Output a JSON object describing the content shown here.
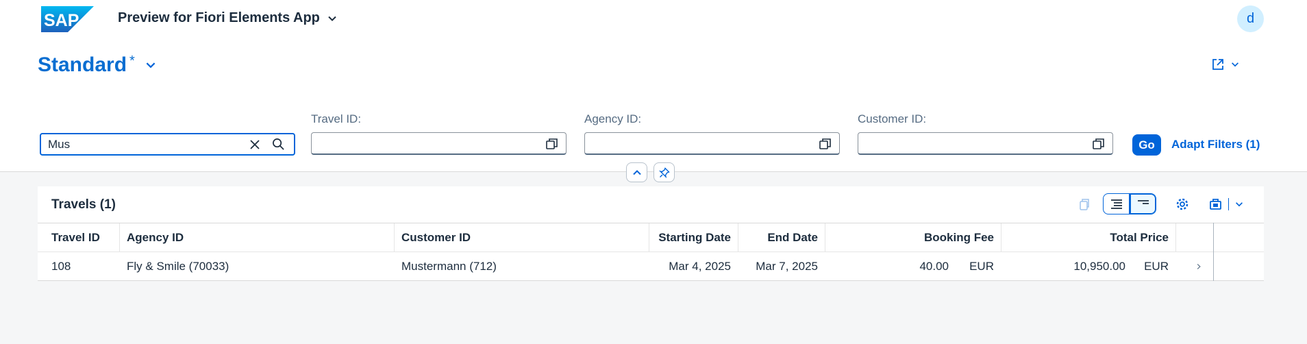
{
  "shell": {
    "logo_text": "SAP",
    "app_title": "Preview for Fiori Elements App",
    "avatar_initial": "d"
  },
  "header": {
    "variant_name": "Standard",
    "variant_modified": "*",
    "search": {
      "value": "Mus"
    },
    "filters": [
      {
        "label": "Travel ID:",
        "value": ""
      },
      {
        "label": "Agency ID:",
        "value": ""
      },
      {
        "label": "Customer ID:",
        "value": ""
      }
    ],
    "go_label": "Go",
    "adapt_label": "Adapt Filters (1)"
  },
  "table": {
    "title": "Travels (1)",
    "columns": [
      "Travel ID",
      "Agency ID",
      "Customer ID",
      "Starting Date",
      "End Date",
      "Booking Fee",
      "Total Price"
    ],
    "rows": [
      {
        "travel_id": "108",
        "agency": "Fly & Smile (70033)",
        "customer": "Mustermann (712)",
        "start": "Mar 4, 2025",
        "end": "Mar 7, 2025",
        "fee": "40.00",
        "fee_cur": "EUR",
        "total": "10,950.00",
        "total_cur": "EUR"
      }
    ]
  },
  "colors": {
    "brand_blue": "#0064d9",
    "title_blue": "#0a6ed1",
    "text": "#1d2d3e",
    "label": "#556b82",
    "background": "#f5f6f7"
  }
}
